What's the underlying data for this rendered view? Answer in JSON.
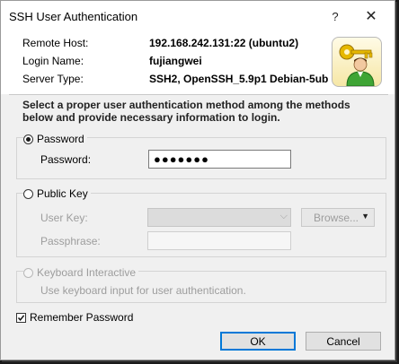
{
  "window": {
    "title": "SSH User Authentication",
    "help_glyph": "?",
    "close_glyph": "✕"
  },
  "info": {
    "remote_host_label": "Remote Host:",
    "remote_host_value": "192.168.242.131:22 (ubuntu2)",
    "login_name_label": "Login Name:",
    "login_name_value": "fujiangwei",
    "server_type_label": "Server Type:",
    "server_type_value": "SSH2, OpenSSH_5.9p1 Debian-5ub",
    "logo_icon": "key-user-icon"
  },
  "instructions": "Select a proper user authentication method among the methods below and provide necessary information to login.",
  "password_group": {
    "radio_label": "Password",
    "selected": true,
    "field_label": "Password:",
    "field_value": "●●●●●●●"
  },
  "public_key_group": {
    "radio_label": "Public Key",
    "selected": false,
    "user_key_label": "User Key:",
    "user_key_value": "",
    "browse_label": "Browse...",
    "passphrase_label": "Passphrase:",
    "passphrase_value": ""
  },
  "keyboard_group": {
    "radio_label": "Keyboard Interactive",
    "enabled": false,
    "description": "Use keyboard input for user authentication."
  },
  "remember_password": {
    "label": "Remember Password",
    "checked": true
  },
  "buttons": {
    "ok": "OK",
    "cancel": "Cancel"
  },
  "colors": {
    "accent": "#0078d7",
    "disabled_text": "#9d9d9d"
  }
}
